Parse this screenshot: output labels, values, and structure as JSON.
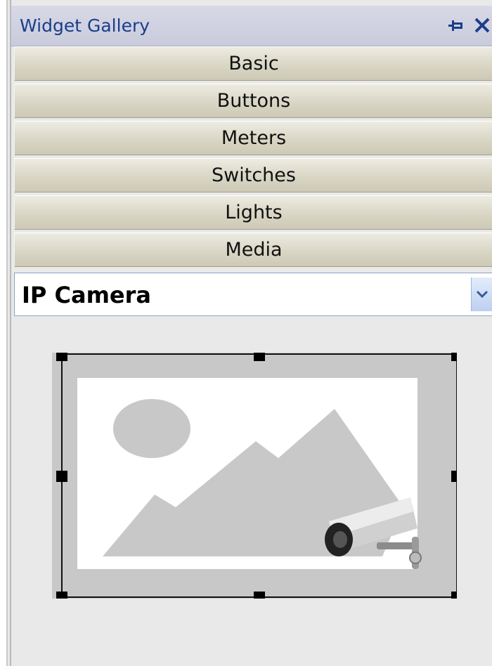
{
  "window": {
    "title": "Widget Gallery",
    "pin_icon": "pin-icon",
    "close_icon": "close-icon"
  },
  "categories": [
    {
      "label": "Basic"
    },
    {
      "label": "Buttons"
    },
    {
      "label": "Meters"
    },
    {
      "label": "Switches"
    },
    {
      "label": "Lights"
    },
    {
      "label": "Media"
    }
  ],
  "widget_select": {
    "value": "IP Camera"
  },
  "preview": {
    "icon": "ip-camera-placeholder-icon",
    "colors": {
      "frame": "#c8c8c8",
      "image_bg": "#ffffff",
      "shapes": "#c8c8c8",
      "selection": "#111111"
    }
  },
  "colors": {
    "titlebar": "#cfd0e0",
    "title_text": "#1a3e8a",
    "panel_bg": "#e9e9e9",
    "category_button": "#dedbc9"
  }
}
